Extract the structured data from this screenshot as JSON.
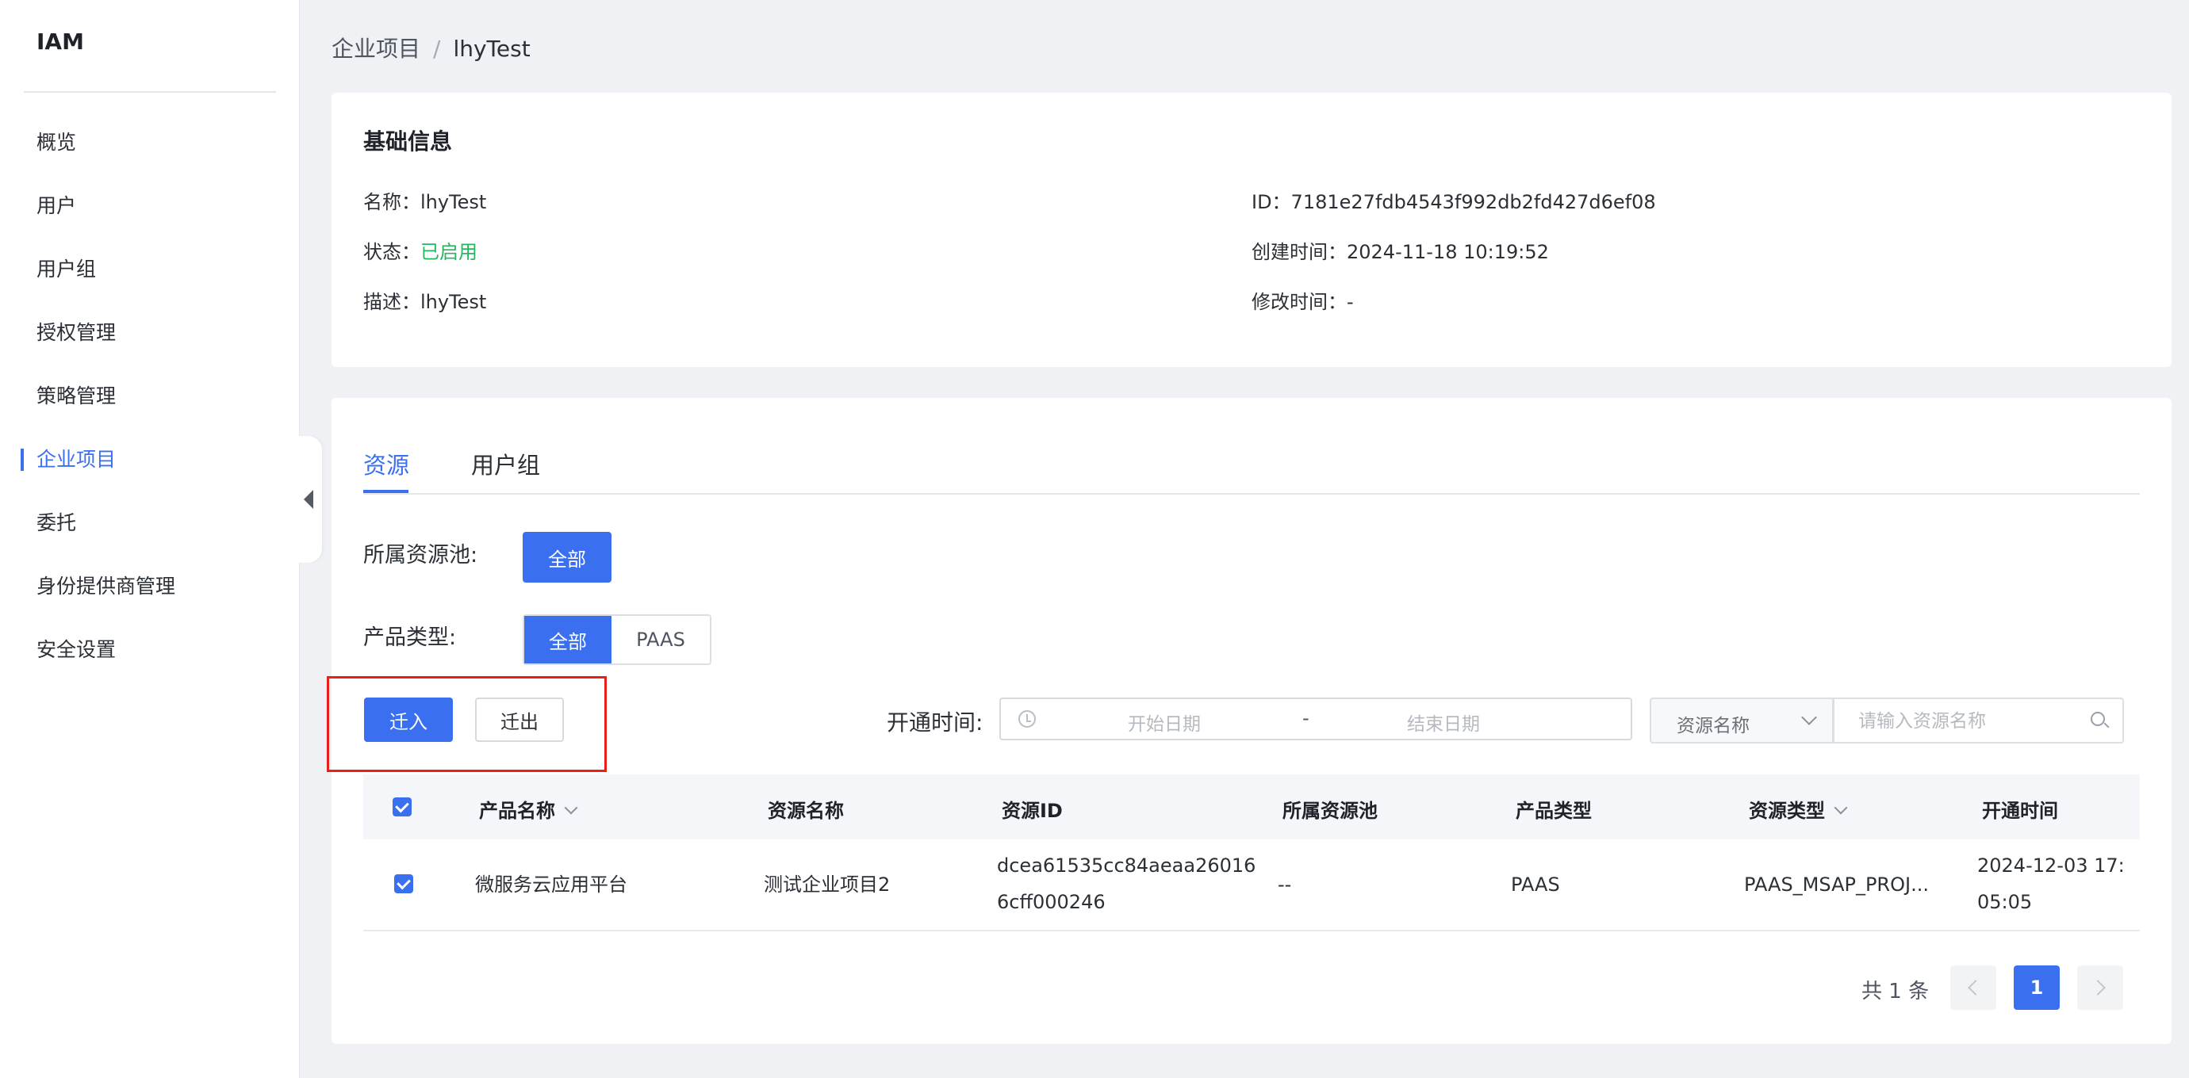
{
  "sidebar": {
    "logo": "IAM",
    "items": [
      {
        "label": "概览"
      },
      {
        "label": "用户"
      },
      {
        "label": "用户组"
      },
      {
        "label": "授权管理"
      },
      {
        "label": "策略管理"
      },
      {
        "label": "企业项目",
        "active": true
      },
      {
        "label": "委托"
      },
      {
        "label": "身份提供商管理"
      },
      {
        "label": "安全设置"
      }
    ]
  },
  "breadcrumb": {
    "parent": "企业项目",
    "separator": "/",
    "current": "lhyTest"
  },
  "basic_info": {
    "title": "基础信息",
    "name": "名称：lhyTest",
    "status_label": "状态：",
    "status_value": "已启用",
    "description": "描述：lhyTest",
    "id": "ID：7181e27fdb4543f992db2fd427d6ef08",
    "created": "创建时间：2024-11-18 10:19:52",
    "modified": "修改时间：-"
  },
  "tabs": [
    {
      "label": "资源",
      "active": true
    },
    {
      "label": "用户组"
    }
  ],
  "filters": {
    "pool_label": "所属资源池:",
    "pool_all": "全部",
    "product_type_label": "产品类型:",
    "product_type_options": [
      "全部",
      "PAAS"
    ]
  },
  "actions": {
    "move_in": "迁入",
    "move_out": "迁出"
  },
  "open_time": {
    "label": "开通时间:",
    "start_placeholder": "开始日期",
    "separator": "-",
    "end_placeholder": "结束日期"
  },
  "search": {
    "field_select": "资源名称",
    "placeholder": "请输入资源名称"
  },
  "table": {
    "columns": [
      "产品名称",
      "资源名称",
      "资源ID",
      "所属资源池",
      "产品类型",
      "资源类型",
      "开通时间"
    ],
    "rows": [
      {
        "product_name": "微服务云应用平台",
        "resource_name": "测试企业项目2",
        "resource_id_line1": "dcea61535cc84aeaa26016",
        "resource_id_line2": "6cff000246",
        "pool": "--",
        "product_type": "PAAS",
        "resource_type": "PAAS_MSAP_PROJ...",
        "open_time_line1": "2024-12-03 17:",
        "open_time_line2": "05:05"
      }
    ]
  },
  "pagination": {
    "total": "共 1 条",
    "current_page": "1"
  },
  "colors": {
    "accent": "#3a6ff0",
    "success": "#26b660",
    "highlight_border": "#e8201b"
  }
}
